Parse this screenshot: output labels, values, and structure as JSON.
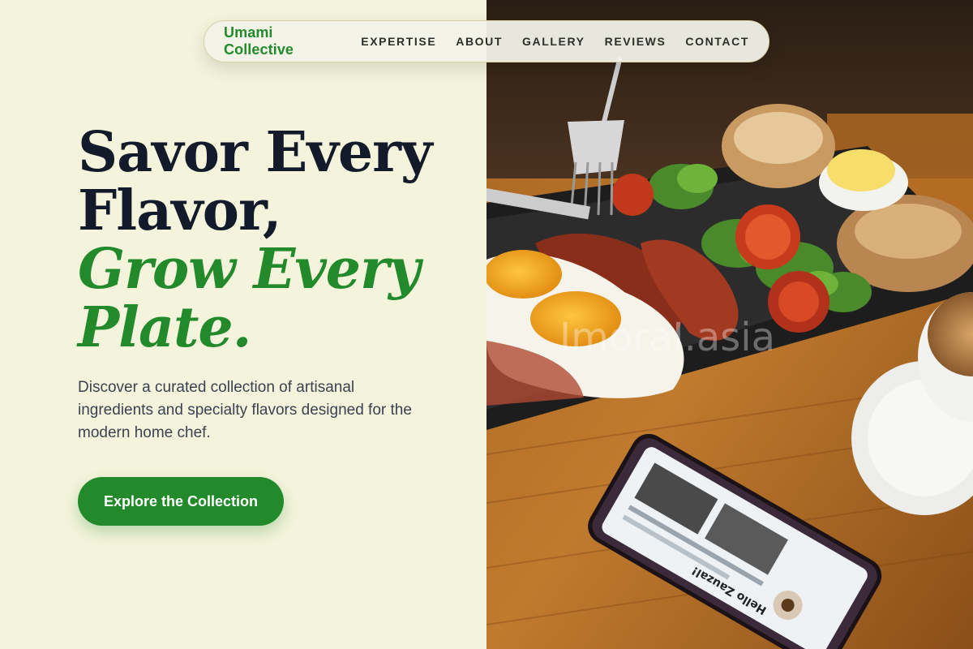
{
  "nav": {
    "brand": "Umami Collective",
    "links": [
      "EXPERTISE",
      "ABOUT",
      "GALLERY",
      "REVIEWS",
      "CONTACT"
    ]
  },
  "hero": {
    "title_line1": "Savor Every",
    "title_line2": "Flavor,",
    "title_accent_line1": "Grow Every",
    "title_accent_line2": "Plate.",
    "description": "Discover a curated collection of artisanal ingredients and specialty flavors designed for the modern home chef.",
    "cta_label": "Explore the Collection"
  },
  "hero_image": {
    "watermark": "ImoraI.asia",
    "phone_screen_text": "Hello Zauzal!"
  },
  "colors": {
    "brand_green": "#238a2c",
    "heading_dark": "#131a2a",
    "background_cream": "#f4f4dc"
  }
}
